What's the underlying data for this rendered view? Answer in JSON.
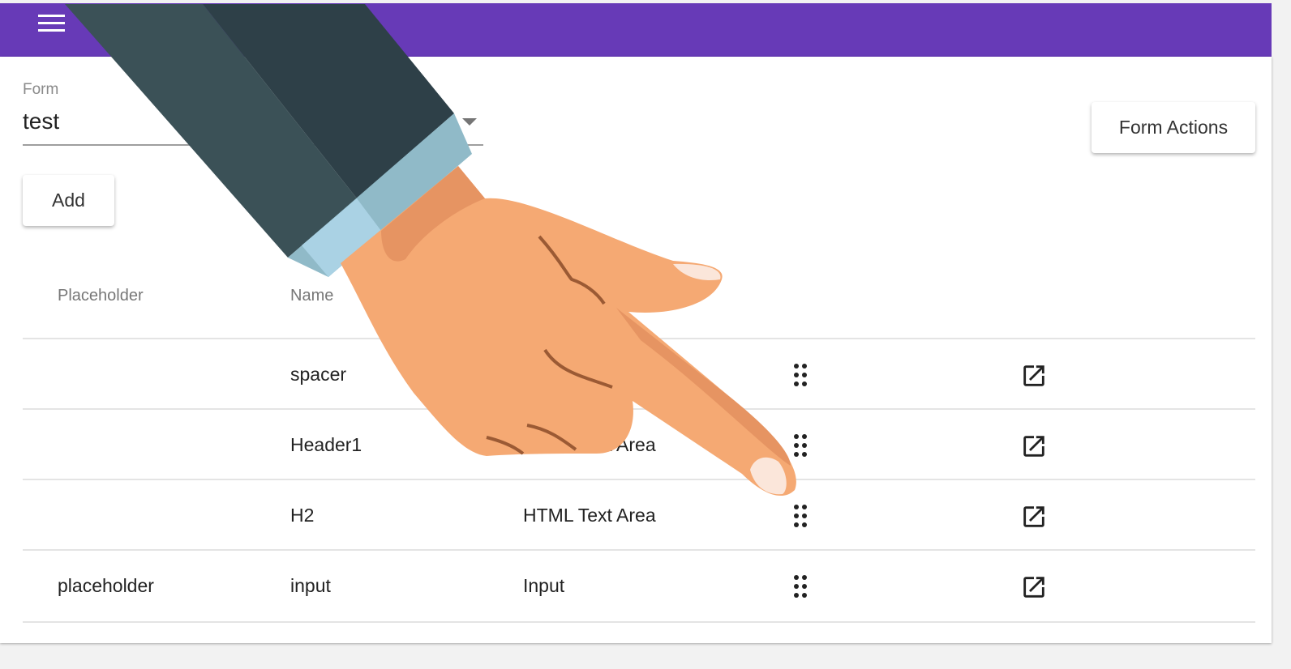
{
  "app": {
    "accent_color": "#673ab7",
    "menu_icon": "hamburger-menu-icon"
  },
  "form_selector": {
    "label": "Form",
    "value": "test"
  },
  "buttons": {
    "add": "Add",
    "form_actions": "Form Actions"
  },
  "table": {
    "headers": {
      "placeholder": "Placeholder",
      "name": "Name"
    },
    "rows": [
      {
        "placeholder": "",
        "name": "spacer",
        "type": ""
      },
      {
        "placeholder": "",
        "name": "Header1",
        "type": "HTML Text Area"
      },
      {
        "placeholder": "",
        "name": "H2",
        "type": "HTML Text Area"
      },
      {
        "placeholder": "placeholder",
        "name": "input",
        "type": "Input"
      }
    ],
    "row_icons": [
      "drag-handle-icon",
      "open-in-new-icon"
    ]
  },
  "overlay": {
    "illustration": "pointing-hand"
  }
}
